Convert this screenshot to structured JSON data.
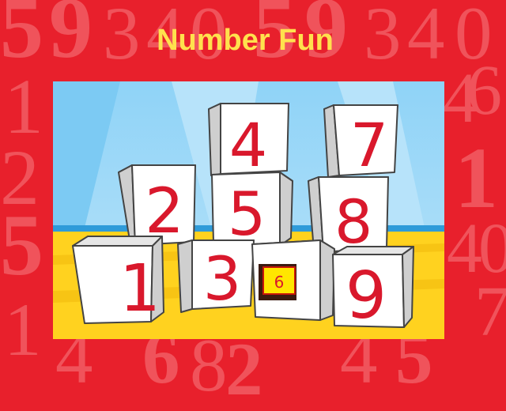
{
  "title": "Number Fun",
  "background_digits": [
    "5",
    "9",
    "3",
    "4",
    "0",
    "5",
    "9",
    "3",
    "4",
    "0",
    "1",
    "4",
    "6",
    "8",
    "2",
    "7",
    "9",
    "2",
    "1",
    "5",
    "4",
    "0",
    "1",
    "4",
    "8",
    "1",
    "4",
    "6",
    "8",
    "9",
    "2",
    "1",
    "4",
    "0",
    "5",
    "7",
    "6"
  ],
  "blocks": [
    {
      "number": "1",
      "state": "normal"
    },
    {
      "number": "2",
      "state": "normal"
    },
    {
      "number": "3",
      "state": "normal"
    },
    {
      "number": "4",
      "state": "normal"
    },
    {
      "number": "5",
      "state": "normal"
    },
    {
      "number": "6",
      "state": "highlighted"
    },
    {
      "number": "7",
      "state": "normal"
    },
    {
      "number": "8",
      "state": "normal"
    },
    {
      "number": "9",
      "state": "normal"
    }
  ],
  "colors": {
    "background": "#e8202c",
    "title": "#ffe14d",
    "digit": "#d9182c",
    "sky": "#8fd3f7",
    "floor": "#ffd21f",
    "highlight": "#ffe600"
  }
}
